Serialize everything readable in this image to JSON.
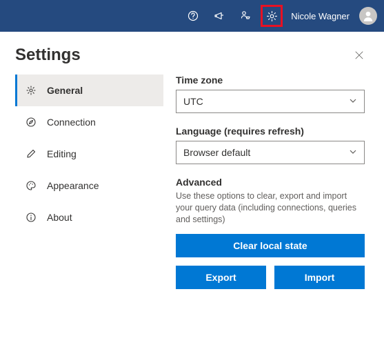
{
  "topbar": {
    "user_name": "Nicole Wagner"
  },
  "panel": {
    "title": "Settings"
  },
  "sidebar": {
    "items": [
      {
        "label": "General"
      },
      {
        "label": "Connection"
      },
      {
        "label": "Editing"
      },
      {
        "label": "Appearance"
      },
      {
        "label": "About"
      }
    ]
  },
  "content": {
    "timezone": {
      "label": "Time zone",
      "value": "UTC"
    },
    "language": {
      "label": "Language (requires refresh)",
      "value": "Browser default"
    },
    "advanced": {
      "label": "Advanced",
      "description": "Use these options to clear, export and import your query data (including connections, queries and settings)",
      "clear_button": "Clear local state",
      "export_button": "Export",
      "import_button": "Import"
    }
  }
}
